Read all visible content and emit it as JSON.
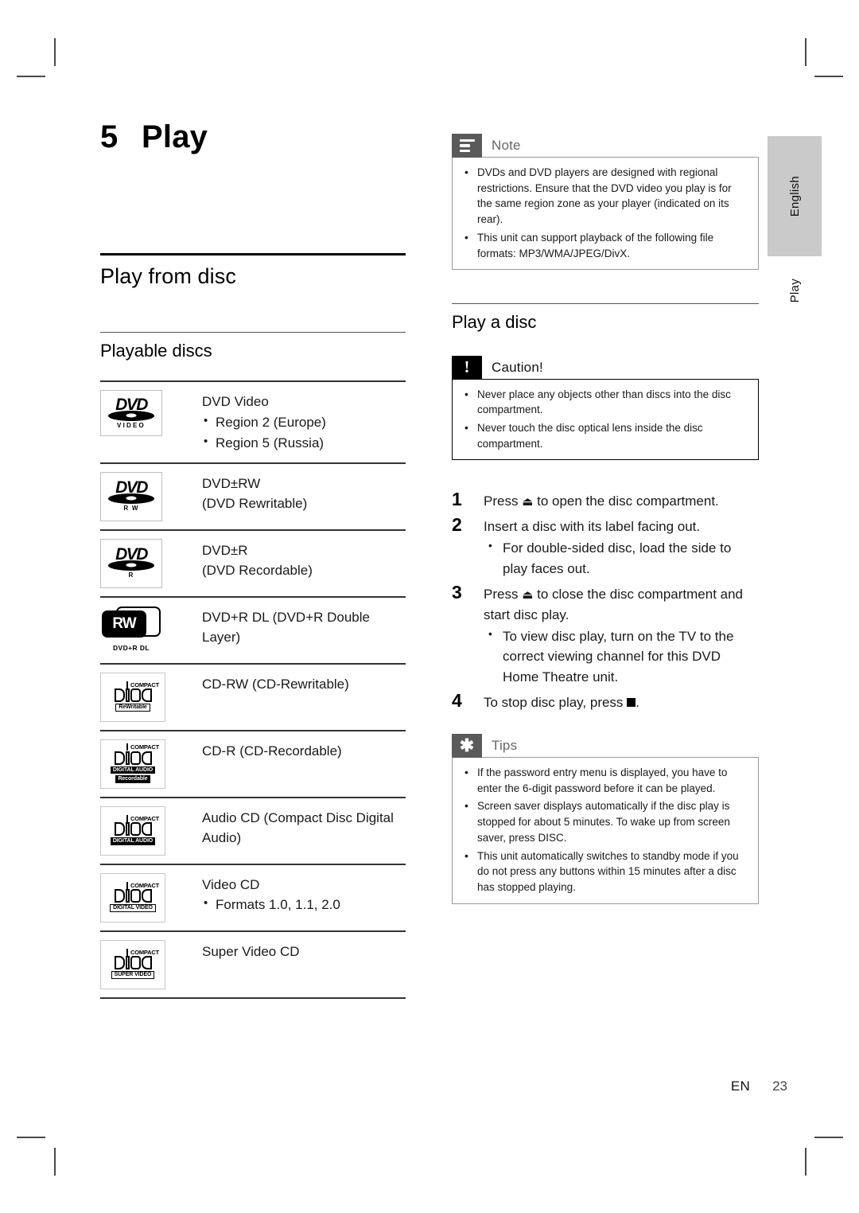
{
  "page": {
    "chapter_number": "5",
    "chapter_title": "Play",
    "footer_locale": "EN",
    "footer_page": "23",
    "edge_tab_language": "English",
    "edge_tab_section": "Play"
  },
  "left": {
    "section_heading": "Play from disc",
    "subsection_heading": "Playable discs",
    "discs": [
      {
        "logo": "dvd-video-logo",
        "title": "DVD Video",
        "bullets": [
          "Region 2 (Europe)",
          "Region 5 (Russia)"
        ]
      },
      {
        "logo": "dvd-rw-logo",
        "title": "DVD±RW",
        "subtitle": "(DVD Rewritable)",
        "bullets": []
      },
      {
        "logo": "dvd-r-logo",
        "title": "DVD±R",
        "subtitle": "(DVD Recordable)",
        "bullets": []
      },
      {
        "logo": "dvd-plus-r-dl-logo",
        "title": "DVD+R DL (DVD+R Double Layer)",
        "bullets": []
      },
      {
        "logo": "cd-rw-logo",
        "title": "CD-RW (CD-Rewritable)",
        "bullets": []
      },
      {
        "logo": "cd-r-logo",
        "title": "CD-R (CD-Recordable)",
        "bullets": []
      },
      {
        "logo": "audio-cd-logo",
        "title": "Audio CD (Compact Disc Digital Audio)",
        "bullets": []
      },
      {
        "logo": "video-cd-logo",
        "title": "Video CD",
        "bullets": [
          "Formats 1.0, 1.1, 2.0"
        ]
      },
      {
        "logo": "super-video-cd-logo",
        "title": "Super Video CD",
        "bullets": []
      }
    ],
    "logo_labels": {
      "dvd_word": "DVD",
      "video": "VIDEO",
      "rw": "R W",
      "r": "R",
      "rw_mark": "RW",
      "dvd_plus_r_dl": "DVD+R DL",
      "compact": "COMPACT",
      "rewritable": "ReWritable",
      "digital_audio": "DIGITAL AUDIO",
      "recordable": "Recordable",
      "digital_video": "DIGITAL VIDEO",
      "super_video": "SUPER VIDEO"
    }
  },
  "right": {
    "note_box": {
      "label": "Note",
      "icon": "note-lines-icon",
      "items": [
        "DVDs and DVD players are designed with regional restrictions.  Ensure that the DVD video you play is for the same region zone as your player (indicated on its rear).",
        "This unit can support playback of the following file formats: MP3/WMA/JPEG/DivX."
      ]
    },
    "section_heading": "Play a disc",
    "caution_box": {
      "label": "Caution!",
      "icon": "exclamation-icon",
      "items": [
        "Never place any objects other than discs into the disc compartment.",
        "Never touch the disc optical lens inside the disc compartment."
      ]
    },
    "steps": [
      {
        "num": "1",
        "text_before": "Press ",
        "icon": "eject-icon",
        "text_after": " to open the disc compartment.",
        "sub": []
      },
      {
        "num": "2",
        "text_before": "Insert a disc with its label facing out.",
        "icon": "",
        "text_after": "",
        "sub": [
          "For double-sided disc, load the side to play faces out."
        ]
      },
      {
        "num": "3",
        "text_before": "Press ",
        "icon": "eject-icon",
        "text_after": " to close the disc compartment and start disc play.",
        "sub": [
          "To view disc play, turn on the TV to the correct viewing channel for this DVD Home Theatre unit."
        ]
      },
      {
        "num": "4",
        "text_before": "To stop disc play, press ",
        "icon": "stop-square-icon",
        "text_after": ".",
        "sub": []
      }
    ],
    "tips_box": {
      "label": "Tips",
      "icon": "asterisk-icon",
      "items": [
        "If the password entry menu is displayed, you have to enter the 6-digit password before it can be played.",
        "Screen saver displays automatically if the disc play is stopped for about 5 minutes. To wake up from screen saver, press DISC.",
        "This unit automatically switches to standby mode if you do not press any buttons within 15 minutes after a disc has stopped playing."
      ]
    }
  },
  "glyphs": {
    "eject": "⏏",
    "bullet": "•"
  }
}
